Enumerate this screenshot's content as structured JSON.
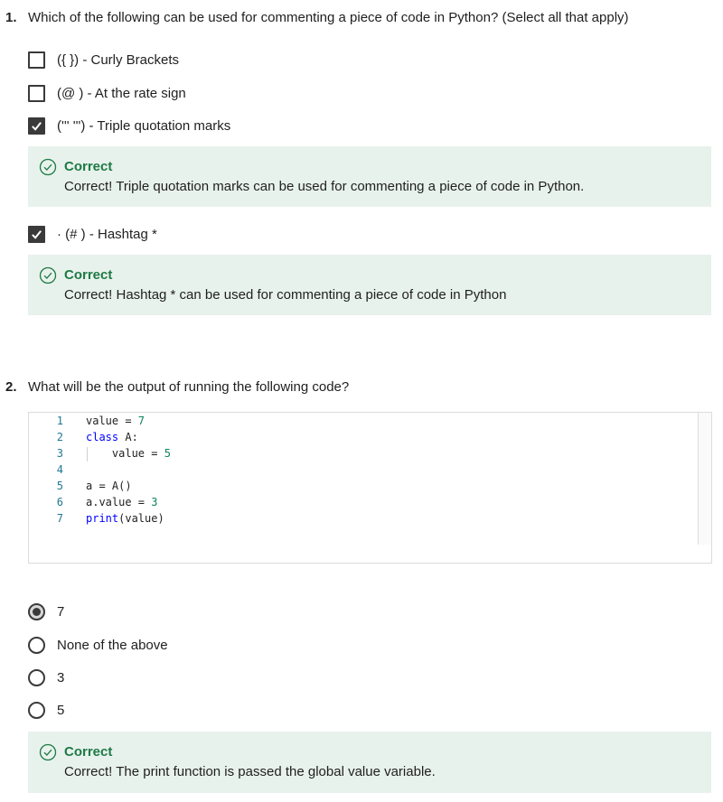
{
  "q1": {
    "number": "1.",
    "text": "Which of the following can be used for commenting a piece of code in Python? (Select all that apply)",
    "options": [
      {
        "label": "({ }) - Curly Brackets",
        "checked": false
      },
      {
        "label": "(@ ) - At the rate sign",
        "checked": false
      },
      {
        "label": "(''' ''') - Triple quotation marks",
        "checked": true
      },
      {
        "label": "· (# ) - Hashtag *",
        "checked": true
      }
    ],
    "feedback": [
      {
        "title": "Correct",
        "message": "Correct! Triple quotation marks can be used for commenting a piece of code in Python."
      },
      {
        "title": "Correct",
        "message": "Correct! Hashtag * can be used for commenting a piece of code in Python"
      }
    ]
  },
  "q2": {
    "number": "2.",
    "text": "What will be the output of running the following code?",
    "code_lines": [
      {
        "n": "1",
        "code": "value = 7"
      },
      {
        "n": "2",
        "code": "class A:"
      },
      {
        "n": "3",
        "code": "    value = 5"
      },
      {
        "n": "4",
        "code": ""
      },
      {
        "n": "5",
        "code": "a = A()"
      },
      {
        "n": "6",
        "code": "a.value = 3"
      },
      {
        "n": "7",
        "code": "print(value)"
      }
    ],
    "options": [
      {
        "label": "7",
        "selected": true
      },
      {
        "label": "None of the above",
        "selected": false
      },
      {
        "label": "3",
        "selected": false
      },
      {
        "label": "5",
        "selected": false
      }
    ],
    "feedback": {
      "title": "Correct",
      "message": "Correct! The print function is passed the global value variable."
    }
  },
  "colors": {
    "correct": "#1e7a45",
    "feedback_bg": "#e8f2ec",
    "control": "#3a3a3a"
  }
}
